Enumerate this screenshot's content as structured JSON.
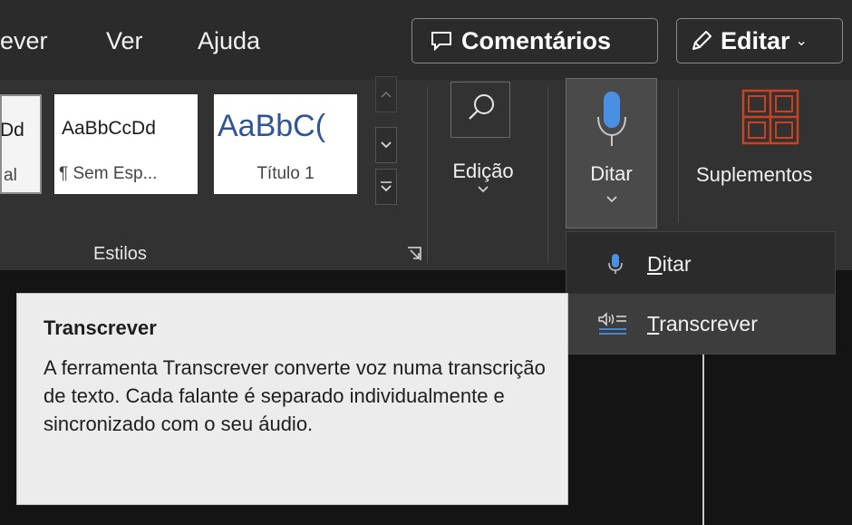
{
  "menu": {
    "items": [
      "ever",
      "Ver",
      "Ajuda"
    ],
    "comments_label": "Comentários",
    "edit_label": "Editar",
    "edit_chevron": "⌄"
  },
  "styles_gallery": {
    "tiles": [
      {
        "sample": "Dd",
        "name": "al"
      },
      {
        "sample": "AaBbCcDd",
        "name": "¶ Sem Esp..."
      },
      {
        "sample": "AaBbC(",
        "name": "Título 1"
      }
    ],
    "group_label": "Estilos"
  },
  "ribbon": {
    "editing_label": "Edição",
    "dictate_label": "Ditar",
    "addins_label": "Suplementos"
  },
  "dropdown": {
    "items": [
      {
        "accel": "D",
        "rest": "itar"
      },
      {
        "accel": "T",
        "rest": "ranscrever"
      }
    ]
  },
  "tooltip": {
    "title": "Transcrever",
    "body": "A ferramenta Transcrever converte voz numa transcrição de texto. Cada falante é separado individualmente e sincronizado com o seu áudio."
  },
  "colors": {
    "accent_blue": "#4a90e2",
    "addins_orange": "#c8431f",
    "ribbon_bg": "#323232",
    "menubar_bg": "#2b2b2b",
    "tooltip_bg": "#ececec"
  },
  "icons": {
    "comments": "speech-bubble-icon",
    "edit": "pencil-icon",
    "search": "search-icon",
    "dictate": "microphone-icon",
    "addins": "grid-icon",
    "transcribe": "transcribe-icon",
    "dialog_launcher": "dialog-launcher-icon"
  }
}
